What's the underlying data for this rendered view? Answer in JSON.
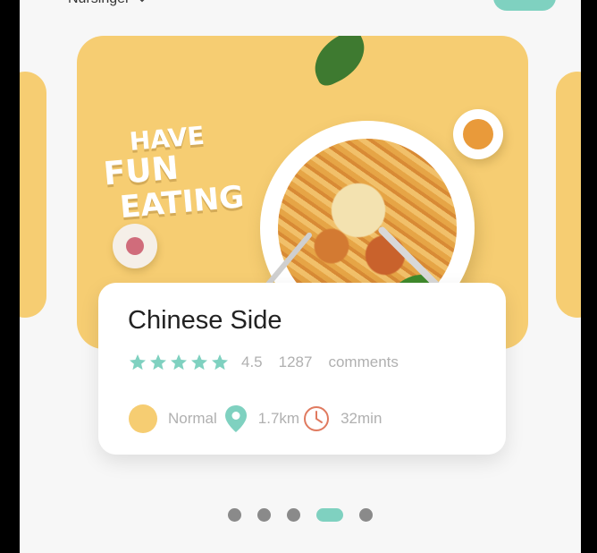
{
  "header": {
    "location": "Nursinger",
    "dropdown_icon": "chevron-down-icon"
  },
  "hero": {
    "line1": "HAVE",
    "line2": "FUN",
    "line3": "EATING"
  },
  "card": {
    "title": "Chinese Side",
    "rating_value": "4.5",
    "rating_stars": 5,
    "comment_count": "1287",
    "comments_label": "comments",
    "level": "Normal",
    "distance": "1.7km",
    "time": "32min"
  },
  "colors": {
    "accent": "#7fd1c0",
    "hero_bg": "#f6cd72",
    "clock": "#e07a5f",
    "dot_inactive": "#8a8a8a"
  },
  "pagination": {
    "count": 5,
    "active_index": 3
  }
}
